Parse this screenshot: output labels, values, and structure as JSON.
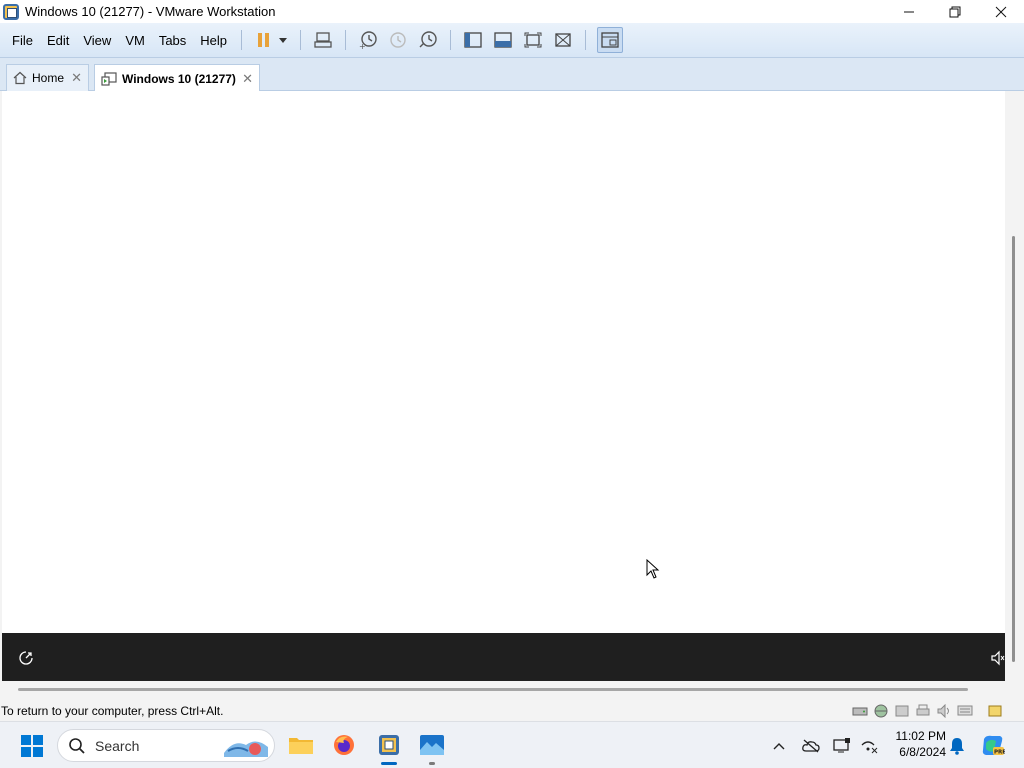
{
  "window": {
    "title": "Windows 10 (21277) - VMware Workstation",
    "controls": {
      "minimize": "—",
      "maximize": "❐",
      "close": "✕"
    }
  },
  "menu": {
    "items": [
      "File",
      "Edit",
      "View",
      "VM",
      "Tabs",
      "Help"
    ]
  },
  "toolbar": {
    "icons": [
      "pause-icon",
      "dropdown-icon",
      "send-ctrl-alt-del-icon",
      "snapshot-take-icon",
      "snapshot-revert-icon",
      "snapshot-manager-icon",
      "library-icon",
      "console-view-icon",
      "full-screen-icon",
      "unity-icon",
      "thumbnail-view-icon"
    ]
  },
  "tabs": [
    {
      "label": "Home",
      "icon": "home-icon",
      "active": false
    },
    {
      "label": "Windows 10 (21277)",
      "icon": "vm-icon",
      "active": true
    }
  ],
  "vm_screen": {
    "background": "#ffffff",
    "bottom_bar_color": "#1f1f1f"
  },
  "statusbar": {
    "message": "To return to your computer, press Ctrl+Alt.",
    "icons": [
      "hard-disk-icon",
      "network-icon",
      "usb-icon",
      "printer-icon",
      "sound-icon",
      "display-icon",
      "message-icon"
    ]
  },
  "taskbar": {
    "search_placeholder": "Search",
    "apps": [
      "file-explorer-icon",
      "firefox-icon",
      "vmware-workstation-icon",
      "photos-icon"
    ],
    "tray": [
      "chevron-up-icon",
      "onedrive-icon",
      "display-settings-icon",
      "network-sound-icon",
      "notifications-icon"
    ],
    "time": "11:02 PM",
    "date": "6/8/2024"
  },
  "colors": {
    "accent": "#0067c0",
    "toolbar_bg": "#d7e6f6",
    "pause_orange": "#e8a23a"
  }
}
